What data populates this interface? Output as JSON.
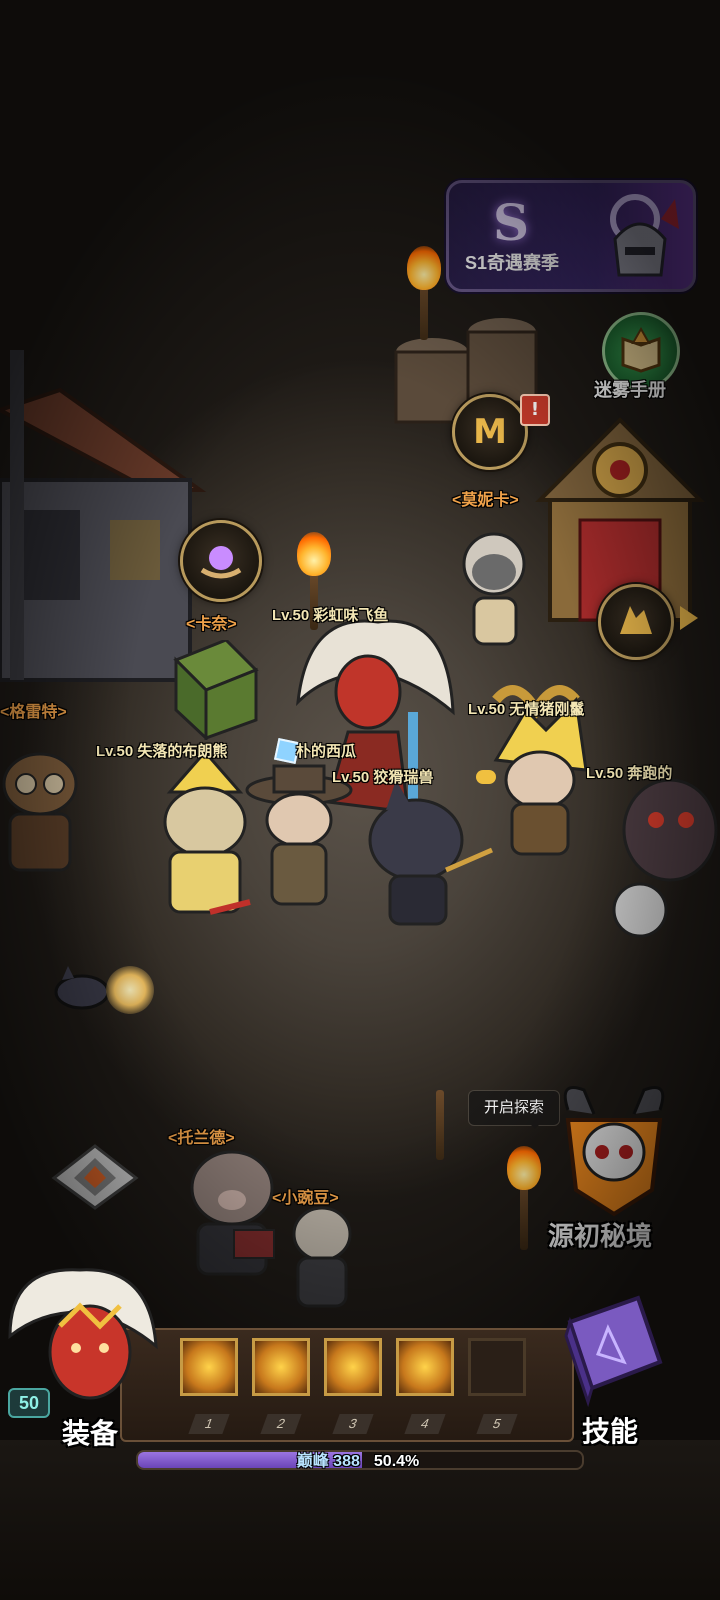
{
  "season": {
    "label": "S1奇遇赛季",
    "icon": "S"
  },
  "fog_manual": {
    "label": "迷雾手册"
  },
  "npcs": {
    "monica": "<莫妮卡>",
    "kanai": "<卡奈>",
    "gret": "<格雷特>",
    "toland": "<托兰德>",
    "xiaowandou": "<小豌豆>"
  },
  "players": {
    "p1": "Lv.50 彩虹味飞鱼",
    "p2": "Lv.50 失落的布朗熊",
    "p2b": "朴的西瓜",
    "p3": "Lv.50 狡猾瑞兽",
    "p4": "Lv.50 无情猪刚鬣",
    "p5": "Lv.50 奔跑的"
  },
  "explore": {
    "tip": "开启探索",
    "realm_label": "源初秘境"
  },
  "hud": {
    "level": "50",
    "equip_label": "装备",
    "skill_label": "技能",
    "slot_numbers": [
      "1",
      "2",
      "3",
      "4",
      "5"
    ],
    "xp_peak": "巅峰 388",
    "xp_percent": "50.4%",
    "xp_fraction": 0.504
  },
  "colors": {
    "accent": "#f0a24a",
    "xp": "#6a44b8"
  }
}
